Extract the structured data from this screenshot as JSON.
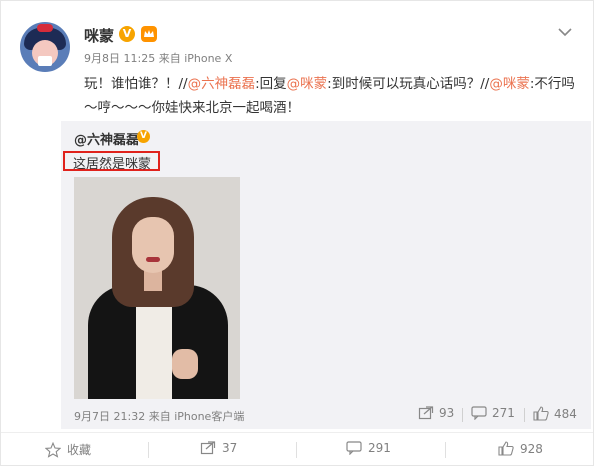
{
  "post": {
    "username": "咪蒙",
    "verified_badge": "V",
    "date": "9月8日 11:25",
    "source": "来自 iPhone X",
    "text_parts": [
      "玩！谁怕谁？！//",
      "@六神磊磊",
      ":回复",
      "@咪蒙",
      ":到时候可以玩真心话吗？//",
      "@咪蒙",
      ":不行吗～哼～～～你娃快来北京一起喝酒！"
    ]
  },
  "quoted": {
    "author": "@六神磊磊",
    "verified_badge": "V",
    "text": "这居然是咪蒙",
    "date": "9月7日 21:32",
    "source": "来自 iPhone客户端",
    "repost_count": "93",
    "comment_count": "271",
    "like_count": "484"
  },
  "actions": {
    "favorite_label": "收藏",
    "repost_count": "37",
    "comment_count": "291",
    "like_count": "928"
  },
  "colors": {
    "link": "#eb7350",
    "highlight_box": "#e0221c",
    "quote_bg": "#f2f2f5",
    "badge": "#f7a400"
  }
}
